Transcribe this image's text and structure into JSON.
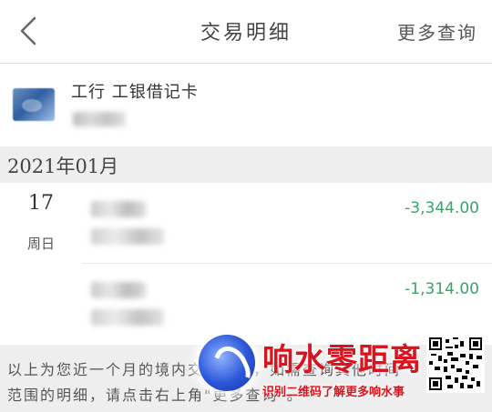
{
  "header": {
    "back_icon": "chevron-left-icon",
    "title": "交易明细",
    "more_label": "更多查询"
  },
  "card": {
    "name": "工行 工银借记卡"
  },
  "month": {
    "label": "2021年01月"
  },
  "day_group": {
    "day": "17",
    "weekday": "周日"
  },
  "transactions": [
    {
      "amount": "-3,344.00"
    },
    {
      "amount": "-1,314.00"
    }
  ],
  "footer": {
    "note": "以上为您近一个月的境内交易明细，如需查询其他时间范围的明细，请点击右上角\"更多查询\"。"
  },
  "watermark": {
    "title": "响水零距离",
    "subtitle": "识别二维码了解更多响水事"
  },
  "colors": {
    "amount": "#3aa36a",
    "watermark": "#d9141e"
  }
}
